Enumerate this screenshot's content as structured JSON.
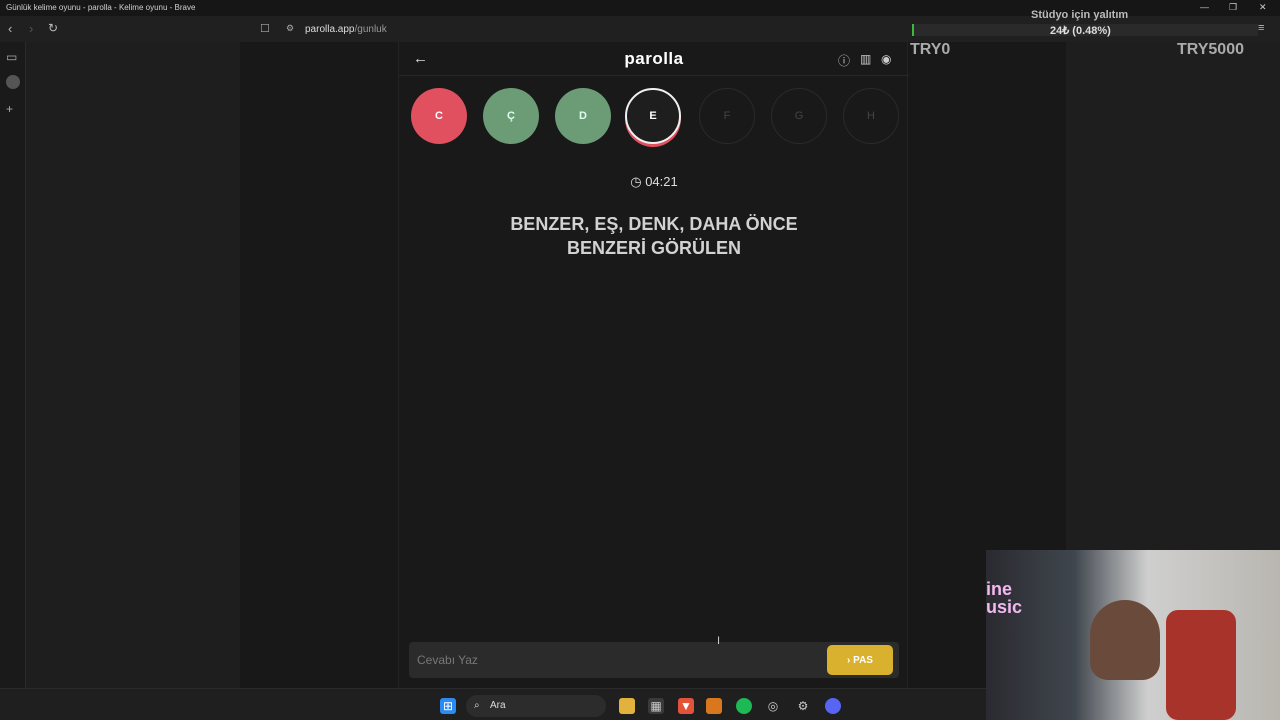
{
  "window": {
    "title": "Günlük kelime oyunu - parolla - Kelime oyunu - Brave",
    "controls": [
      "—",
      "❐",
      "✕"
    ]
  },
  "browser": {
    "url_host": "parolla.app",
    "url_path": "/gunluk"
  },
  "app": {
    "brand": "parolla",
    "letters": [
      {
        "char": "C",
        "state": "wrong"
      },
      {
        "char": "Ç",
        "state": "correct"
      },
      {
        "char": "D",
        "state": "correct"
      },
      {
        "char": "E",
        "state": "active"
      },
      {
        "char": "F",
        "state": "idle"
      },
      {
        "char": "G",
        "state": "idle"
      },
      {
        "char": "H",
        "state": "idle"
      }
    ],
    "timer": "04:21",
    "clue_line1": "BENZER, EŞ, DENK, DAHA ÖNCE",
    "clue_line2": "BENZERİ GÖRÜLEN",
    "answer_placeholder": "Cevabı Yaz",
    "pass_label": "PAS"
  },
  "overlay": {
    "studio_text": "Stüdyo için yalıtım",
    "progress_text": "24₺ (0.48%)",
    "progress_fraction": 0.0048,
    "goal_start": "TRY0",
    "goal_end": "TRY5000"
  },
  "webcam": {
    "neon_text_1": "ine",
    "neon_text_2": "usic"
  },
  "taskbar": {
    "search_label": "Ara"
  },
  "colors": {
    "wrong": "#e0505f",
    "correct": "#6c9c76",
    "pass_button": "#d9b12f"
  }
}
